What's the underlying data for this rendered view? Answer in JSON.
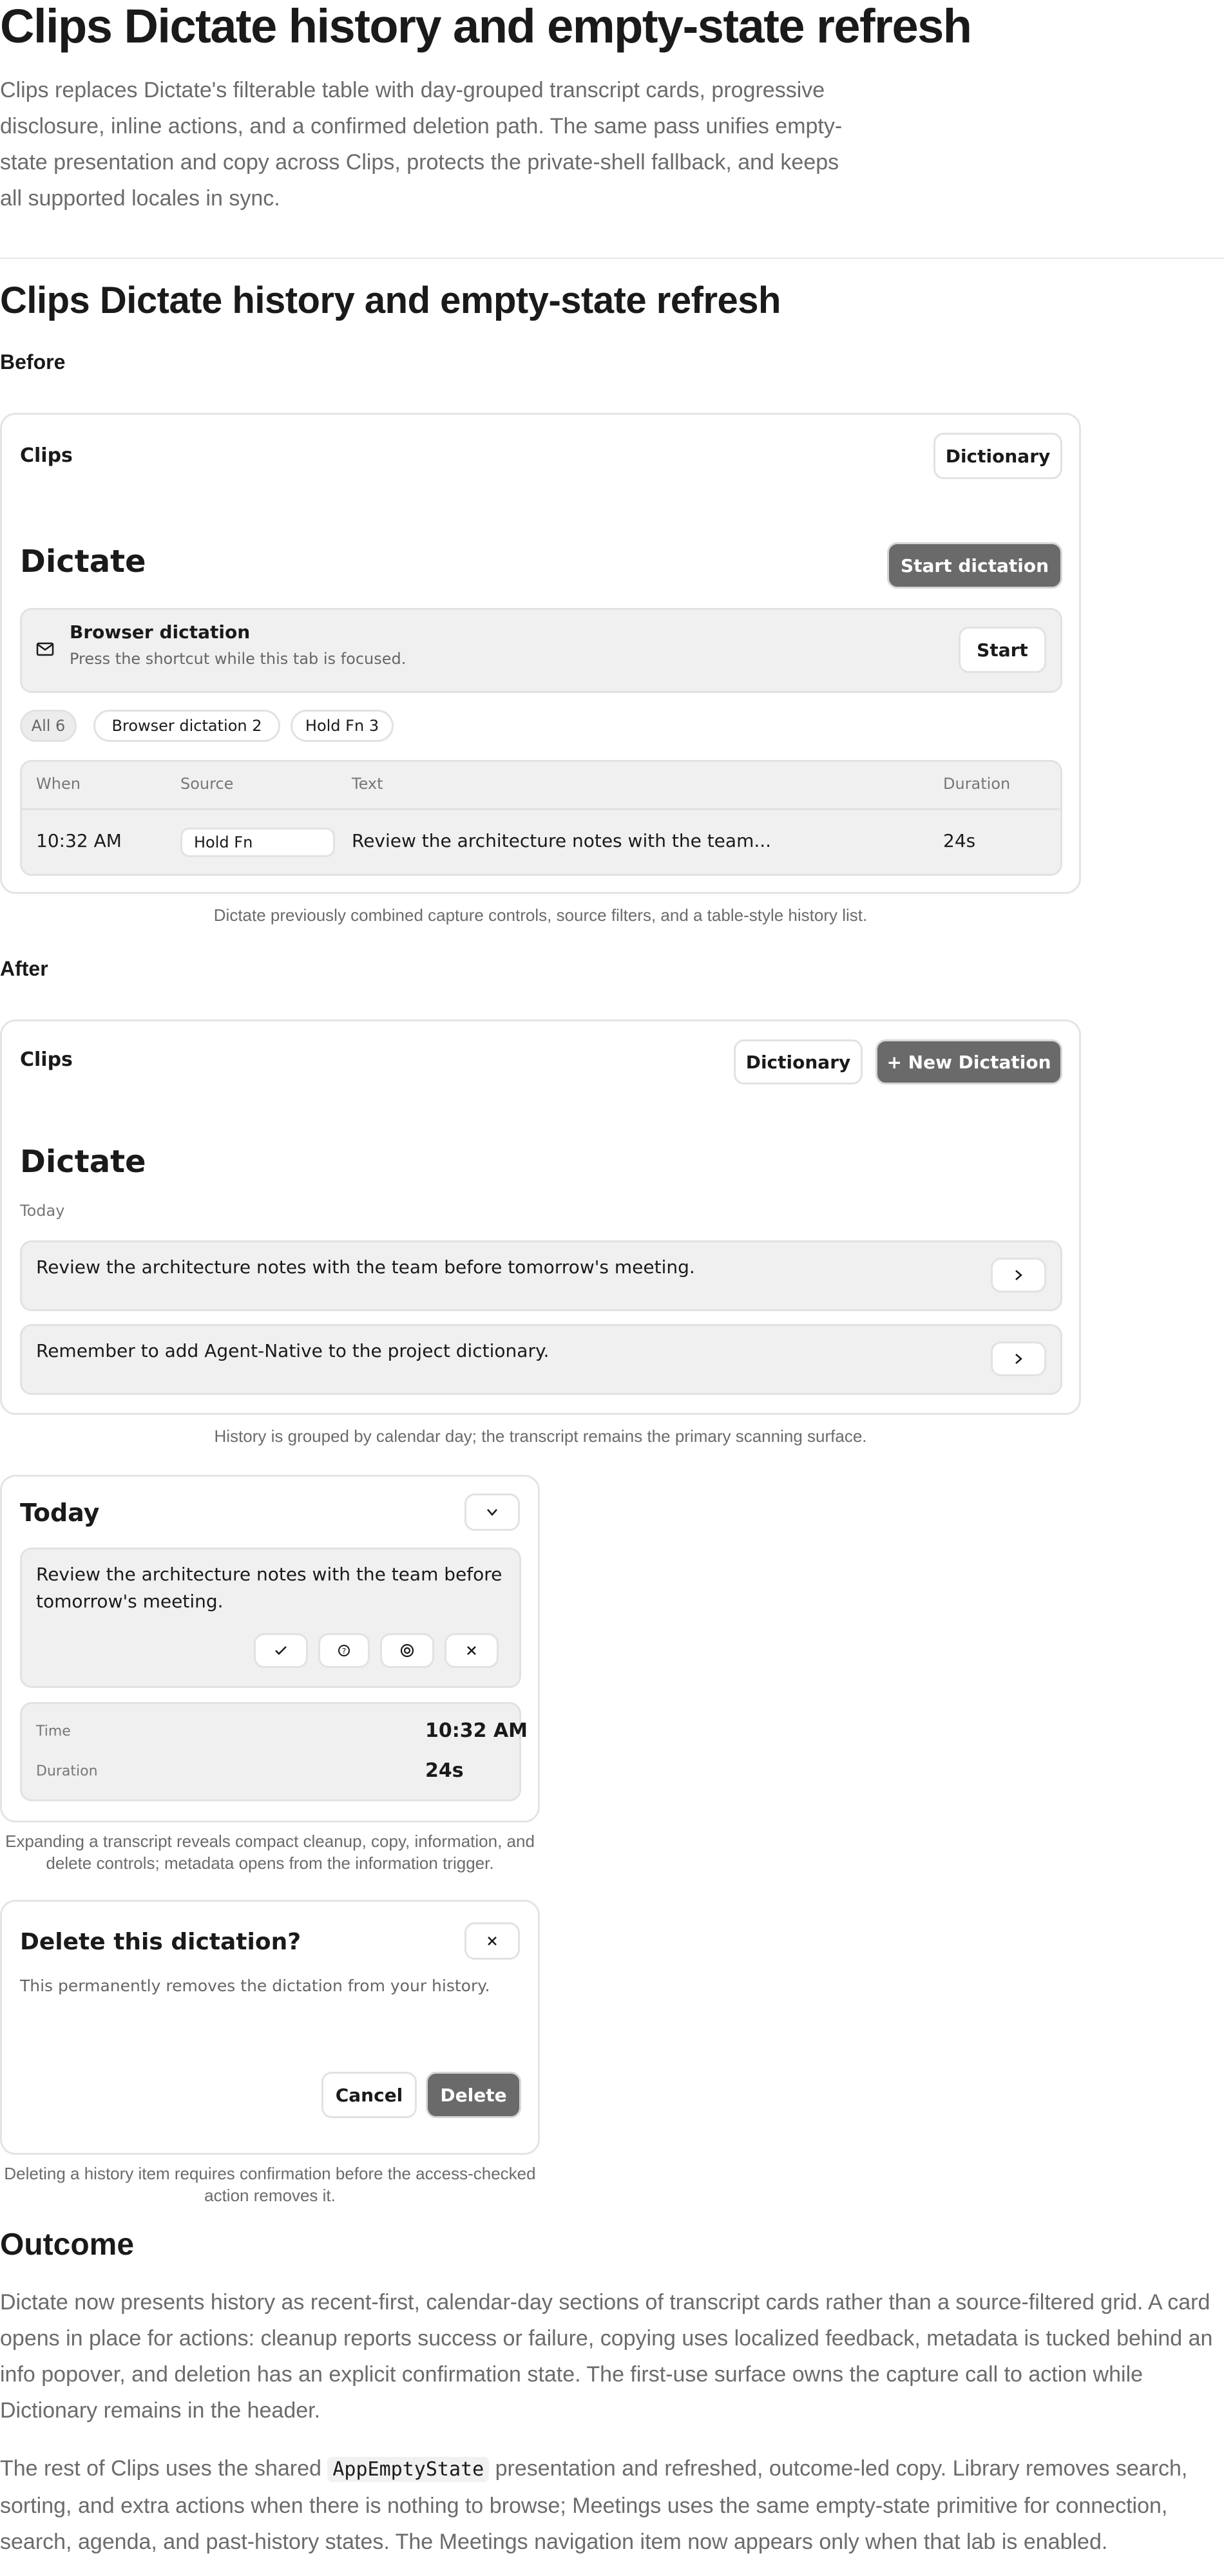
{
  "header": {
    "title": "Clips Dictate history and empty-state refresh",
    "lede": "Clips replaces Dictate's filterable table with day-grouped transcript cards, progressive disclosure, inline actions, and a confirmed deletion path. The same pass unifies empty-state presentation and copy across Clips, protects the private-shell fallback, and keeps all supported locales in sync."
  },
  "section": {
    "title": "Clips Dictate history and empty-state refresh"
  },
  "before": {
    "label": "Before",
    "app_name": "Clips",
    "dictionary_label": "Dictionary",
    "page_title": "Dictate",
    "start_dictation_label": "Start dictation",
    "banner": {
      "icon": "mail-icon",
      "title": "Browser dictation",
      "subtitle": "Press the shortcut while this tab is focused.",
      "start_label": "Start"
    },
    "filters": [
      "All 6",
      "Browser dictation 2",
      "Hold Fn 3"
    ],
    "table": {
      "columns": [
        "When",
        "Source",
        "Text",
        "Duration"
      ],
      "rows": [
        {
          "when": "10:32 AM",
          "source": "Hold Fn",
          "text": "Review the architecture notes with the team...",
          "duration": "24s"
        }
      ]
    },
    "caption": "Dictate previously combined capture controls, source filters, and a table-style history list."
  },
  "after": {
    "label": "After",
    "app_name": "Clips",
    "dictionary_label": "Dictionary",
    "new_dictation_label": "+ New Dictation",
    "page_title": "Dictate",
    "group_label": "Today",
    "items": [
      "Review the architecture notes with the team before tomorrow's meeting.",
      "Remember to add Agent-Native to the project dictionary."
    ],
    "caption": "History is grouped by calendar day; the transcript remains the primary scanning surface."
  },
  "expanded": {
    "title": "Today",
    "transcript": "Review the architecture notes with the team before tomorrow's meeting.",
    "actions": [
      "check-icon",
      "info-icon",
      "copy-icon",
      "close-icon"
    ],
    "meta": [
      {
        "key": "Time",
        "value": "10:32 AM"
      },
      {
        "key": "Duration",
        "value": "24s"
      }
    ],
    "caption": "Expanding a transcript reveals compact cleanup, copy, information, and delete controls; metadata opens from the information trigger."
  },
  "delete_dialog": {
    "title": "Delete this dictation?",
    "body": "This permanently removes the dictation from your history.",
    "cancel_label": "Cancel",
    "delete_label": "Delete",
    "caption": "Deleting a history item requires confirmation before the access-checked action removes it."
  },
  "outcome": {
    "title": "Outcome",
    "p1": "Dictate now presents history as recent-first, calendar-day sections of transcript cards rather than a source-filtered grid. A card opens in place for actions: cleanup reports success or failure, copying uses localized feedback, metadata is tucked behind an info popover, and deletion has an explicit confirmation state. The first-use surface owns the capture call to action while Dictionary remains in the header.",
    "p2_pre": "The rest of Clips uses the shared ",
    "p2_code": "AppEmptyState",
    "p2_post": " presentation and refreshed, outcome-led copy. Library removes search, sorting, and extra actions when there is nothing to browse; Meetings uses the same empty-state primitive for connection, search, agenda, and past-history states. The Meetings navigation item now appears only when that lab is enabled."
  }
}
